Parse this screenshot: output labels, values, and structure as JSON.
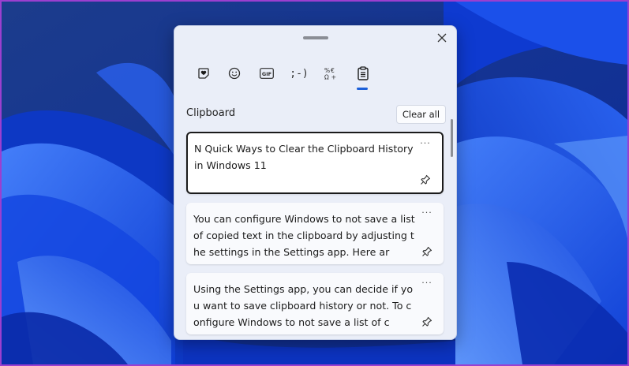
{
  "clipboard_panel": {
    "tabs": [
      {
        "name": "favorites-tab",
        "icon": "sticker-heart-icon",
        "glyph": "♥",
        "active": false
      },
      {
        "name": "emoji-tab",
        "icon": "smiley-icon",
        "glyph": "☺",
        "active": false
      },
      {
        "name": "gif-tab",
        "icon": "gif-icon",
        "glyph": "GIF",
        "active": false
      },
      {
        "name": "kaomoji-tab",
        "icon": "kaomoji-icon",
        "glyph": ";-)",
        "active": false
      },
      {
        "name": "symbols-tab",
        "icon": "symbols-icon",
        "glyph": "%€ Ω+",
        "active": false
      },
      {
        "name": "clipboard-tab",
        "icon": "clipboard-icon",
        "glyph": "",
        "active": true
      }
    ],
    "section_title": "Clipboard",
    "clear_all_label": "Clear all",
    "more_label": "···",
    "items": [
      {
        "text": "N Quick Ways to Clear the Clipboard History in Windows 11",
        "selected": true
      },
      {
        "text": "You can configure Windows to not save a list of copied text in the clipboard by adjusting the settings in the Settings app. Here ar",
        "selected": false
      },
      {
        "text": "Using the Settings app, you can decide if you want to save clipboard history or not. To configure Windows to not save a list of c",
        "selected": false
      }
    ],
    "colors": {
      "accent": "#1c5fd9",
      "panel_bg": "#eaeef8",
      "annotation_arrow": "#9b3fcf",
      "wallpaper_base": "#0a2a9a"
    }
  }
}
